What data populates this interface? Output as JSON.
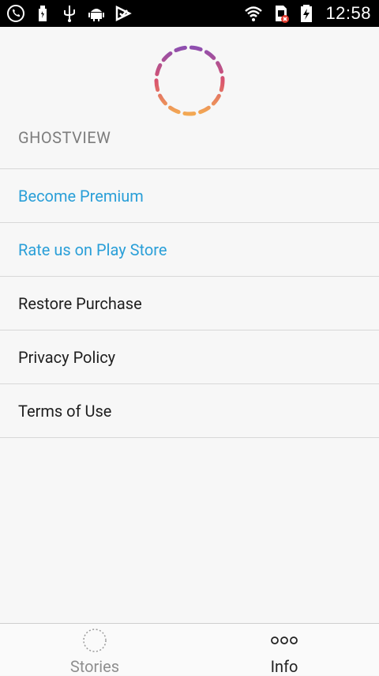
{
  "status_bar": {
    "time": "12:58",
    "left_icons": [
      "viber-icon",
      "usb-icon",
      "usb-debug-icon",
      "android-debug-icon",
      "checkmark-notification-icon"
    ],
    "right_icons": [
      "wifi-icon",
      "sim-error-icon",
      "battery-charging-icon"
    ]
  },
  "app": {
    "name": "GHOSTVIEW"
  },
  "menu": {
    "items": [
      {
        "label": "Become Premium",
        "style": "accent"
      },
      {
        "label": "Rate us on Play Store",
        "style": "accent"
      },
      {
        "label": "Restore Purchase",
        "style": "default"
      },
      {
        "label": "Privacy Policy",
        "style": "default"
      },
      {
        "label": "Terms of Use",
        "style": "default"
      }
    ]
  },
  "tabs": [
    {
      "label": "Stories",
      "icon": "dashed-circle-icon",
      "active": false
    },
    {
      "label": "Info",
      "icon": "three-dots-icon",
      "active": true
    }
  ],
  "colors": {
    "accent": "#2a9fd8",
    "ring_gradient": [
      "#8e4fb0",
      "#d9536e",
      "#f3a953"
    ]
  }
}
